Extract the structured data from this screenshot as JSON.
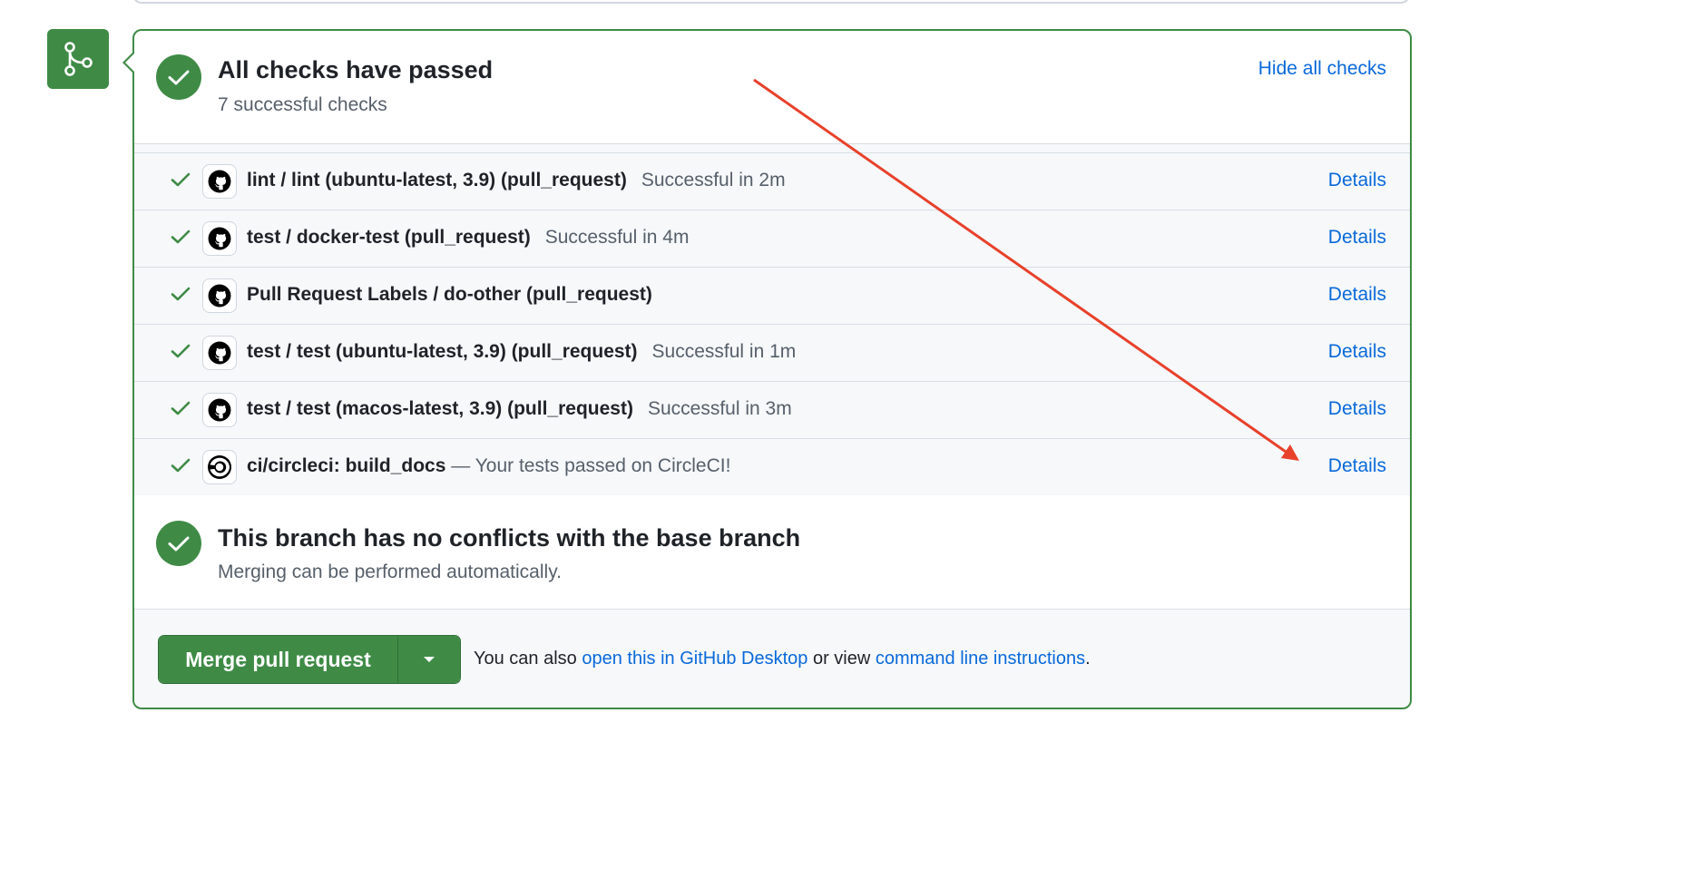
{
  "header": {
    "title": "All checks have passed",
    "subtitle": "7 successful checks",
    "hide_label": "Hide all checks"
  },
  "checks": [
    {
      "icon": "github-icon",
      "name": "lint / lint (ubuntu-latest, 3.9) (pull_request)",
      "status": "Successful in 2m",
      "details_label": "Details"
    },
    {
      "icon": "github-icon",
      "name": "test / docker-test (pull_request)",
      "status": "Successful in 4m",
      "details_label": "Details"
    },
    {
      "icon": "github-icon",
      "name": "Pull Request Labels / do-other (pull_request)",
      "status": "",
      "details_label": "Details"
    },
    {
      "icon": "github-icon",
      "name": "test / test (ubuntu-latest, 3.9) (pull_request)",
      "status": "Successful in 1m",
      "details_label": "Details"
    },
    {
      "icon": "github-icon",
      "name": "test / test (macos-latest, 3.9) (pull_request)",
      "status": "Successful in 3m",
      "details_label": "Details"
    },
    {
      "icon": "circleci-icon",
      "name": "ci/circleci: build_docs",
      "description": " — Your tests passed on CircleCI!",
      "details_label": "Details"
    }
  ],
  "branch": {
    "title": "This branch has no conflicts with the base branch",
    "subtitle": "Merging can be performed automatically."
  },
  "merge": {
    "button_label": "Merge pull request",
    "note_prefix": "You can also ",
    "desktop_link": "open this in GitHub Desktop",
    "note_middle": " or view ",
    "cli_link": "command line instructions",
    "note_suffix": "."
  },
  "colors": {
    "success_green": "#3f8b46",
    "link_blue": "#0969da",
    "annotation_red": "#e8412b"
  }
}
